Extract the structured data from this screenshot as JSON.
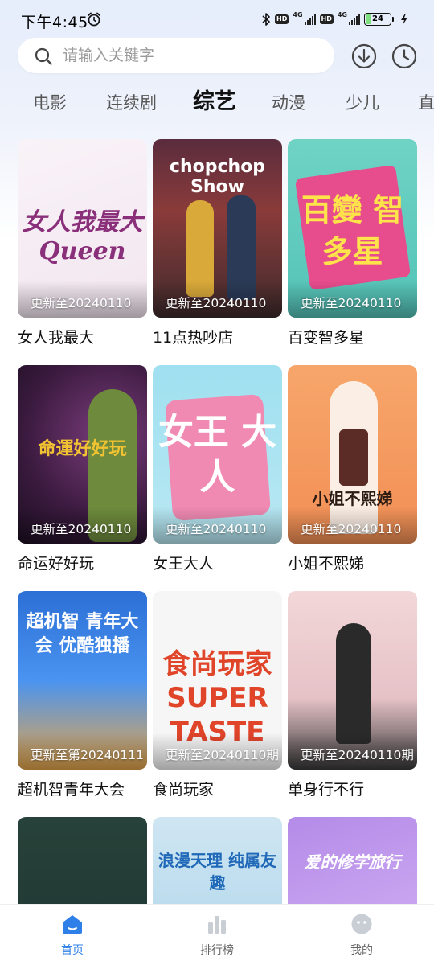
{
  "status_bar": {
    "time": "下午4:45",
    "network_1": "4G",
    "network_2": "4G",
    "hd_label": "HD",
    "battery_level": "24",
    "battery_fraction": 0.24
  },
  "search": {
    "placeholder": "请输入关键字"
  },
  "tabs": [
    {
      "label": "电影"
    },
    {
      "label": "连续剧"
    },
    {
      "label": "综艺",
      "active": true
    },
    {
      "label": "动漫"
    },
    {
      "label": "少儿"
    },
    {
      "label": "直"
    }
  ],
  "items": [
    {
      "title": "女人我最大",
      "update": "更新至20240110",
      "poster_text": "女人我最大 Queen"
    },
    {
      "title": "11点热吵店",
      "update": "更新至20240110",
      "poster_text": "chopchop Show"
    },
    {
      "title": "百变智多星",
      "update": "更新至20240110",
      "poster_text": "百變 智多星"
    },
    {
      "title": "命运好好玩",
      "update": "更新至20240110",
      "poster_text": "命運好好玩"
    },
    {
      "title": "女王大人",
      "update": "更新至20240110",
      "poster_text": "女王 大人"
    },
    {
      "title": "小姐不熙娣",
      "update": "更新至20240110",
      "poster_text": "小姐不熙娣"
    },
    {
      "title": "超机智青年大会",
      "update": "更新至第20240111",
      "poster_text": "超机智 青年大会 优酷独播"
    },
    {
      "title": "食尚玩家",
      "update": "更新至20240110期",
      "poster_text": "食尚玩家 SUPER TASTE"
    },
    {
      "title": "单身行不行",
      "update": "更新至20240110期",
      "poster_text": ""
    },
    {
      "title": "",
      "update": "",
      "poster_text": ""
    },
    {
      "title": "",
      "update": "",
      "poster_text": "浪漫天理 纯属友趣"
    },
    {
      "title": "",
      "update": "",
      "poster_text": "爱的修学旅行"
    }
  ],
  "bottom_nav": [
    {
      "label": "首页",
      "icon": "home-icon",
      "active": true
    },
    {
      "label": "排行榜",
      "icon": "ranking-icon"
    },
    {
      "label": "我的",
      "icon": "profile-icon"
    }
  ],
  "colors": {
    "accent": "#2e7fe8",
    "background_top": "#e6edfb"
  }
}
